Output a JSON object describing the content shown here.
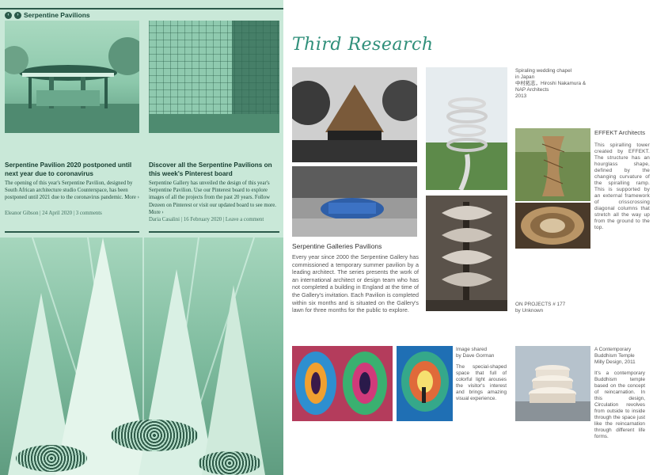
{
  "left_panel": {
    "header": "Serpentine Pavilions",
    "posts": [
      {
        "title": "Serpentine Pavilion 2020 postponed until next year due to coronavirus",
        "body": "The opening of this year's Serpentine Pavilion, designed by South African architecture studio Counterspace, has been postponed until 2021 due to the coronavirus pandemic. More ›",
        "meta": "Eleanor Gibson | 24 April 2020 | 3 comments"
      },
      {
        "title": "Discover all the Serpentine Pavilions on this week's Pinterest board",
        "body": "Serpentine Gallery has unveiled the design of this year's Serpentine Pavilion. Use our Pinterest board to explore images of all the projects from the past 20 years. Follow Dezeen on Pinterest or visit our updated board to see more. More ›",
        "meta": "Daria Casalini | 16 February 2020 | Leave a comment"
      }
    ]
  },
  "right_panel": {
    "heading": "Third Research",
    "serpentine": {
      "title": "Serpentine Galleries Pavilions",
      "body": "Every year since 2000 the Serpentine Gallery has commissioned a temporary summer pavilion by a leading architect. The series presents the work of an international architect or design team who has not completed a building in England at the time of the Gallery's invitation. Each Pavilion is completed within six months and is situated on the Gallery's lawn for three months for the public to explore."
    },
    "chapel": {
      "lines": [
        "Spiraling wedding chapel",
        "in Japan",
        "中村拓志，Hiroshi Nakamura &",
        "NAP Architects",
        "2013"
      ]
    },
    "effekt": {
      "title": "EFFEKT Architects",
      "body": "This spiralling tower created by EFFEKT. The structure has an hourglass shape, defined by the changing curvature of the spiralling ramp. This is supported by an external framework of crisscrossing diagonal columns that stretch all the way up from the ground to the top."
    },
    "on_projects": {
      "lines": [
        "ON PROJECTS # 177",
        "by Unknown"
      ]
    },
    "gorman": {
      "lines": [
        "Image shared",
        "by Dave Gorman"
      ],
      "body": "The special-shaped space that full of colorful light arouses the visitor's interest and brings amazing visual experience."
    },
    "temple": {
      "lines": [
        "A Contemporary",
        "Buddhism Temple",
        "Milly Design, 2011"
      ],
      "body": "It's a contemporary Buddhism temple based on the concept of reincarnation. In this design, Circulation revolves from outside to inside through the space just like the reincarnation through different life forms."
    }
  }
}
